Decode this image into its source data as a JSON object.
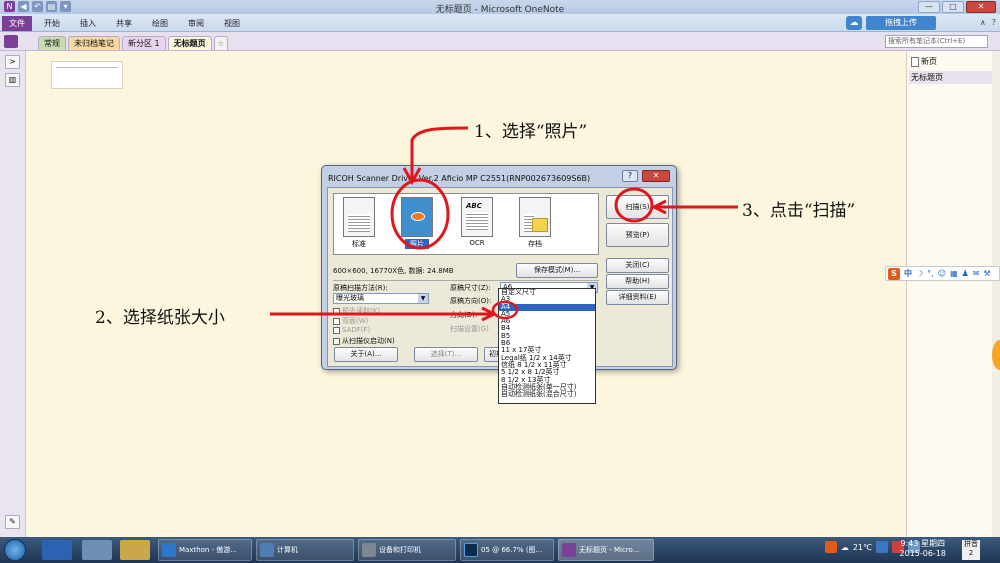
{
  "window": {
    "title": "无标题页 - Microsoft OneNote",
    "controls": [
      "—",
      "□",
      "✕"
    ]
  },
  "ribbon": {
    "file_tab": "文件",
    "tabs": [
      "开始",
      "插入",
      "共享",
      "绘图",
      "审阅",
      "视图"
    ],
    "upload_button": "拖拽上传",
    "right_icons": [
      "∧",
      "?"
    ]
  },
  "sections": {
    "tabs": [
      "常规",
      "未归档笔记",
      "新分区 1",
      "无标题页"
    ],
    "add_tab": "☆",
    "search_placeholder": "搜索所有笔记本(Ctrl+E)"
  },
  "pagelist": {
    "new_page": "新页",
    "pages": [
      "无标题页"
    ]
  },
  "ime": {
    "brand": "S",
    "mode": "中",
    "icons": [
      "☽",
      "°,",
      "☺",
      "▦",
      "♟",
      "✉",
      "⚒"
    ]
  },
  "dialog": {
    "title": "RICOH Scanner Driver Ver.2 Aficio MP C2551(RNP002673609S6B)",
    "help": "?",
    "close": "✕",
    "modes": [
      "标准",
      "照片",
      "OCR",
      "存档"
    ],
    "ocr_thumb_text": "ABC",
    "info": "600×600, 16770X色, 数据: 24.8MB",
    "buttons": {
      "scan": "扫描(S)",
      "preview": "预览(P)",
      "close": "关闭(C)",
      "help": "帮助(H)",
      "detail": "详细资料(E)",
      "save_mode": "保存模式(M)...",
      "about": "关于(A)...",
      "select": "选择(T)...",
      "init": "初期"
    },
    "scan_method_label": "原稿扫描方法(R):",
    "scan_method_value": "曝光玻璃",
    "checks": [
      "预先读取(K)",
      "双面(W)",
      "SADF(F)",
      "从扫描仪启动(N)"
    ],
    "size_label": "原稿尺寸(Z):",
    "size_value": "A6",
    "orient_label": "原稿方向(O):",
    "direction_label": "方向(D):",
    "scan_settings_label": "扫描设置(G)",
    "size_options": [
      "自定义尺寸",
      "A3",
      "A4",
      "A5",
      "A6",
      "B4",
      "B5",
      "B6",
      "11 x 17英寸",
      "Legal纸 1/2 x 14英寸",
      "信纸 8 1/2 x 11英寸",
      "5 1/2 x 8 1/2英寸",
      "8 1/2 x 13英寸",
      "自动检测纸张(单一尺寸)",
      "自动检测纸张(混合尺寸)"
    ],
    "selected_option": "A4"
  },
  "annotations": {
    "step1": "1、选择“照片”",
    "step2": "2、选择纸张大小",
    "step3": "3、点击“扫描”"
  },
  "taskbar": {
    "tasks": [
      "Maxthon - 傲游...",
      "计算机",
      "设备和打印机",
      "05 @ 66.7% (图...",
      "无标题页 - Micro..."
    ],
    "temperature": "21℃",
    "time": "9:43 星期四",
    "date": "2015-06-18",
    "ime_tray": "拼音 2"
  },
  "colors": {
    "onenote_purple": "#7a3f97",
    "page_background": "#fbf6dd",
    "annotation_red": "#e0161c",
    "selection_blue": "#3163c4"
  }
}
